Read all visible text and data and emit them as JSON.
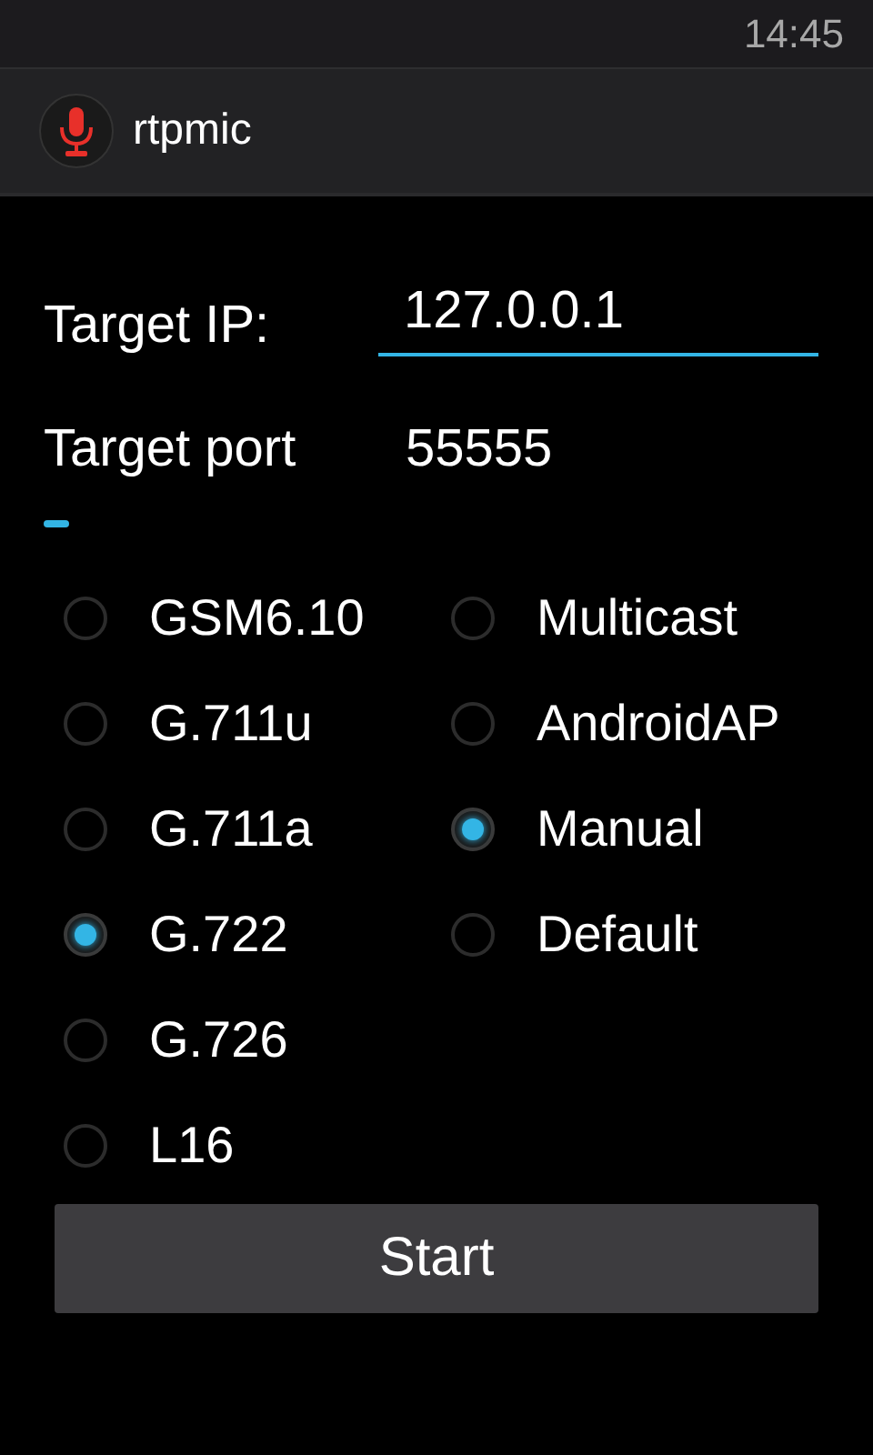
{
  "status_bar": {
    "time": "14:45"
  },
  "action_bar": {
    "title": "rtpmic"
  },
  "target_ip": {
    "label": "Target IP:",
    "value": "127.0.0.1"
  },
  "target_port": {
    "label": "Target port",
    "value": "55555"
  },
  "codecs": [
    {
      "label": "GSM6.10",
      "selected": false
    },
    {
      "label": "G.711u",
      "selected": false
    },
    {
      "label": "G.711a",
      "selected": false
    },
    {
      "label": "G.722",
      "selected": true
    },
    {
      "label": "G.726",
      "selected": false
    },
    {
      "label": "L16",
      "selected": false
    }
  ],
  "modes": [
    {
      "label": "Multicast",
      "selected": false
    },
    {
      "label": "AndroidAP",
      "selected": false
    },
    {
      "label": "Manual",
      "selected": true
    },
    {
      "label": "Default",
      "selected": false
    }
  ],
  "start_button": "Start"
}
